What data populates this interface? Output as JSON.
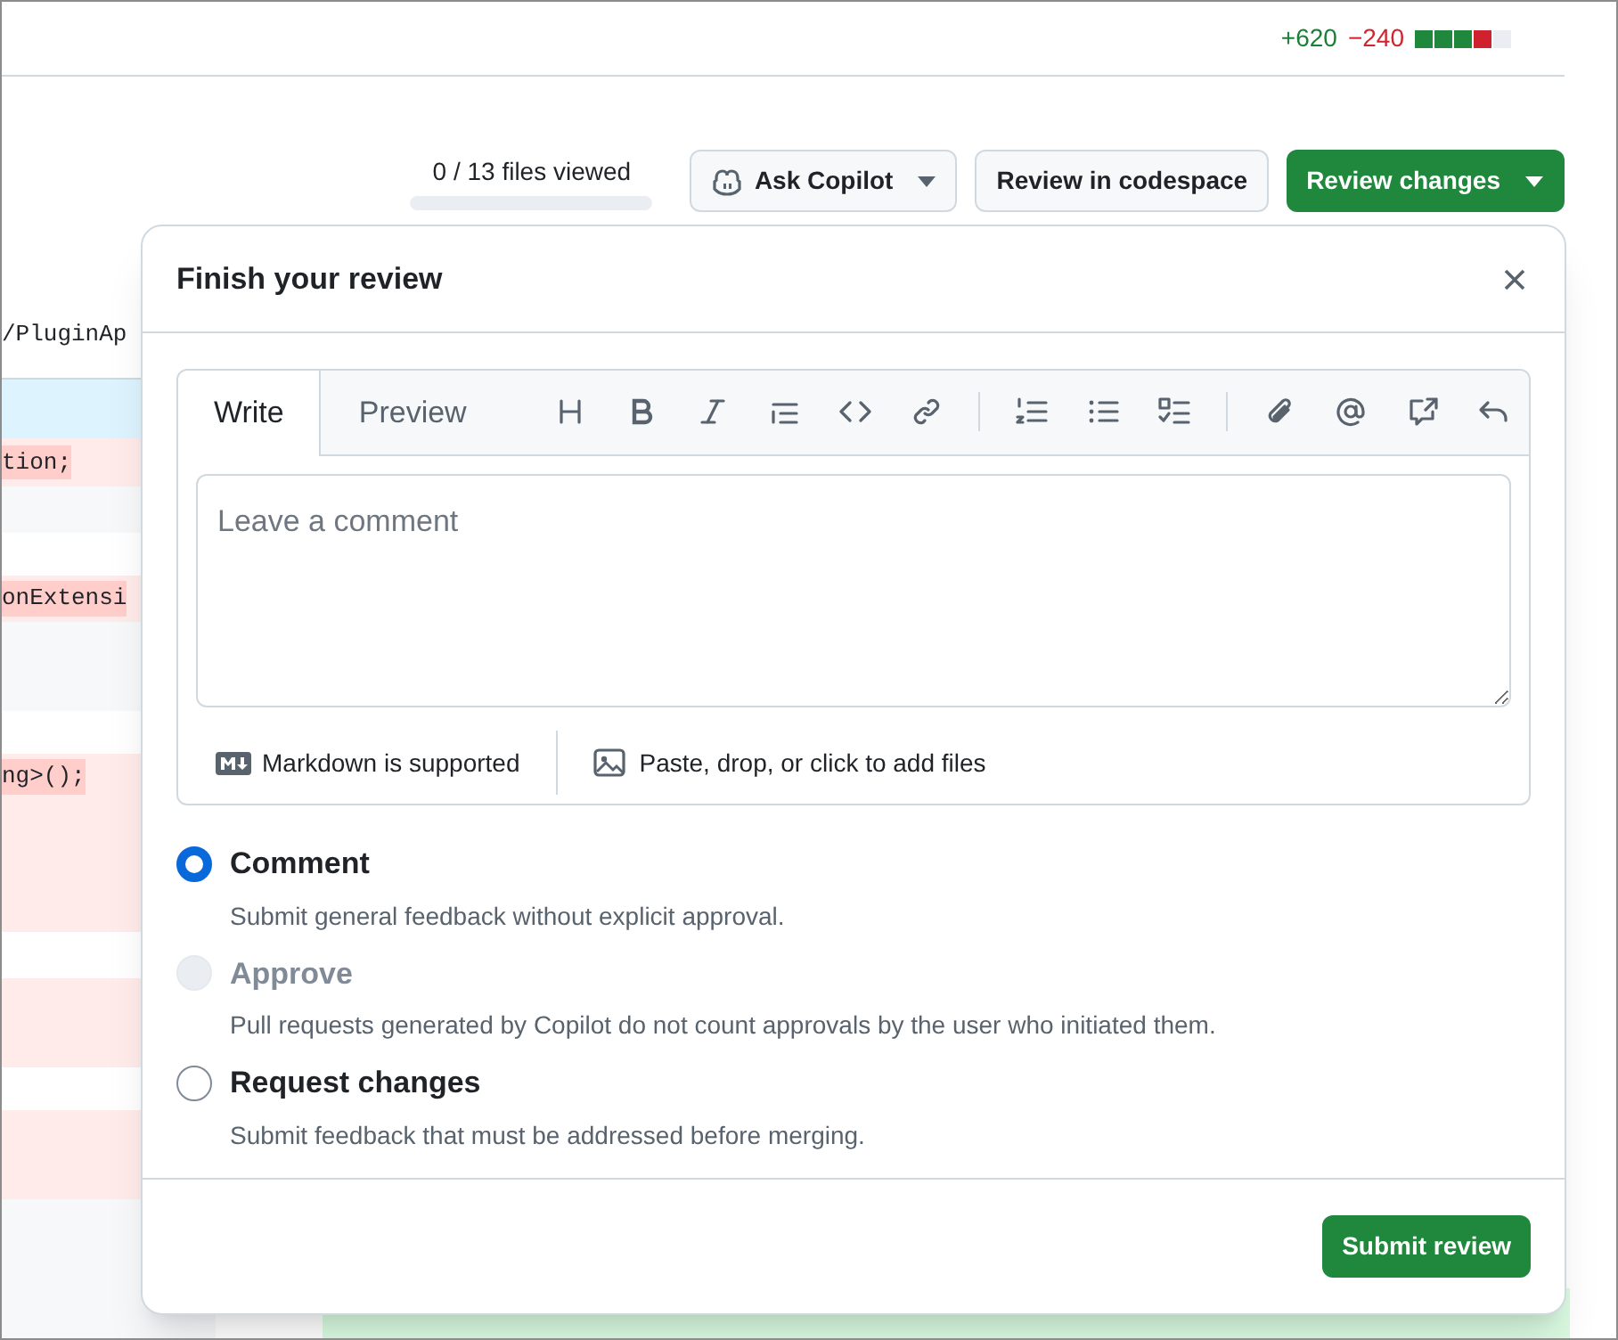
{
  "diffstat": {
    "additions": "+620",
    "deletions": "−240",
    "blocks": [
      {
        "color": "#1f883d"
      },
      {
        "color": "#1f883d"
      },
      {
        "color": "#1f883d"
      },
      {
        "color": "#cf222e"
      },
      {
        "color": "#eaeef2"
      }
    ]
  },
  "toolbar": {
    "files_viewed": "0 / 13 files viewed",
    "files_viewed_progress": {
      "level": 0
    },
    "ask_copilot": "Ask Copilot",
    "review_in_codespace": "Review in codespace",
    "review_changes": "Review changes"
  },
  "code_rows": [
    {
      "kind": "header",
      "text": "/PluginAp"
    },
    {
      "kind": "hunk",
      "text": ""
    },
    {
      "kind": "del",
      "text": "tion;"
    },
    {
      "kind": "ctx",
      "text": ""
    },
    {
      "kind": "blank",
      "text": ""
    },
    {
      "kind": "del",
      "text": "onExtensi"
    },
    {
      "kind": "ctx",
      "text": ""
    },
    {
      "kind": "blank",
      "text": ""
    },
    {
      "kind": "del",
      "text": "ng>();"
    },
    {
      "kind": "del",
      "text": ""
    },
    {
      "kind": "blank",
      "text": ""
    },
    {
      "kind": "del",
      "text": ""
    },
    {
      "kind": "blank",
      "text": ""
    },
    {
      "kind": "del",
      "text": ""
    },
    {
      "kind": "ctx",
      "text": ""
    }
  ],
  "dialog": {
    "title": "Finish your review",
    "tabs": [
      {
        "label": "Write",
        "selected": true
      },
      {
        "label": "Preview",
        "selected": false
      }
    ],
    "comment": {
      "placeholder": "Leave a comment"
    },
    "markdown_note": "Markdown is supported",
    "attach_note": "Paste, drop, or click to add files",
    "options": [
      {
        "label": "Comment",
        "description": "Submit general feedback without explicit approval.",
        "selected": true,
        "disabled": false
      },
      {
        "label": "Approve",
        "description": "Pull requests generated by Copilot do not count approvals by the user who initiated them.",
        "selected": false,
        "disabled": true
      },
      {
        "label": "Request changes",
        "description": "Submit feedback that must be addressed before merging.",
        "selected": false,
        "disabled": false
      }
    ],
    "submit": "Submit review"
  }
}
